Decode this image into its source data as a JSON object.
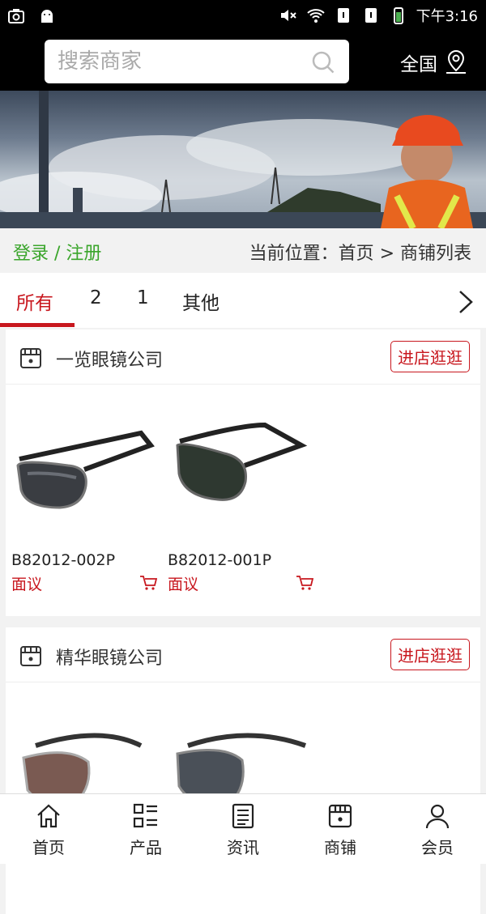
{
  "statusbar": {
    "time": "下午3:16"
  },
  "header": {
    "search_placeholder": "搜索商家",
    "region_label": "全国"
  },
  "crumb": {
    "login": "登录 / 注册",
    "path": "当前位置：首页 > 商铺列表"
  },
  "tabs": [
    "所有",
    "2",
    "1",
    "其他"
  ],
  "shops": [
    {
      "name": "一览眼镜公司",
      "enter_label": "进店逛逛",
      "products": [
        {
          "code": "B82012-002P",
          "price": "面议"
        },
        {
          "code": "B82012-001P",
          "price": "面议"
        }
      ]
    },
    {
      "name": "精华眼镜公司",
      "enter_label": "进店逛逛",
      "products": [
        {
          "code": "",
          "price": ""
        },
        {
          "code": "",
          "price": ""
        }
      ]
    }
  ],
  "nav": [
    "首页",
    "产品",
    "资讯",
    "商铺",
    "会员"
  ],
  "colors": {
    "accent": "#c8171e",
    "login_green": "#3aa52b"
  }
}
